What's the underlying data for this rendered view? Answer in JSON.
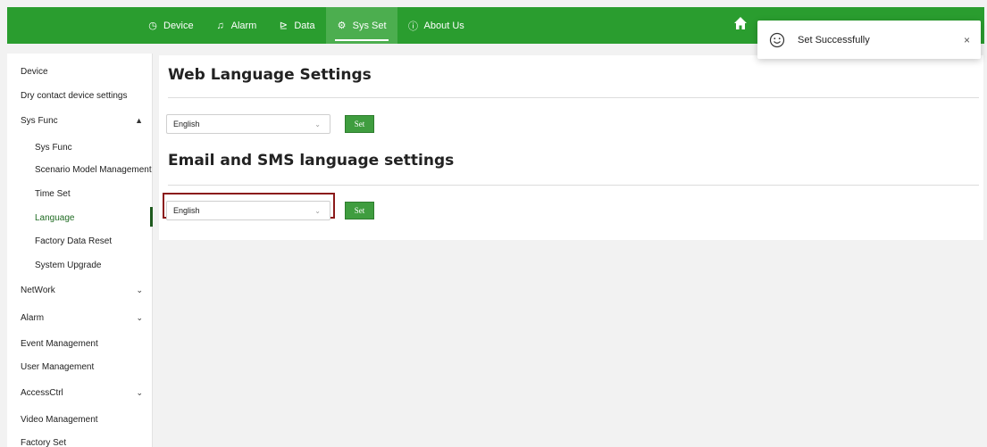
{
  "topnav": {
    "items": [
      {
        "label": "Device",
        "icon": "clock-icon"
      },
      {
        "label": "Alarm",
        "icon": "bell-icon"
      },
      {
        "label": "Data",
        "icon": "chart-icon"
      },
      {
        "label": "Sys Set",
        "icon": "gear-icon"
      },
      {
        "label": "About Us",
        "icon": "info-icon"
      }
    ],
    "active": "Sys Set",
    "brand_color": "#2a9d2f"
  },
  "toast": {
    "message": "Set Successfully",
    "close": "×"
  },
  "sidebar": {
    "items": [
      {
        "label": "Device"
      },
      {
        "label": "Dry contact device settings"
      },
      {
        "label": "Sys Func",
        "chevron": "▲"
      },
      {
        "label": "Sys Func"
      },
      {
        "label": "Scenario Model Management"
      },
      {
        "label": "Time Set"
      },
      {
        "label": "Language"
      },
      {
        "label": "Factory Data Reset"
      },
      {
        "label": "System Upgrade"
      },
      {
        "label": "NetWork",
        "chevron": "⌄"
      },
      {
        "label": "Alarm",
        "chevron": "⌄"
      },
      {
        "label": "Event Management"
      },
      {
        "label": "User Management"
      },
      {
        "label": "AccessCtrl",
        "chevron": "⌄"
      },
      {
        "label": "Video Management"
      },
      {
        "label": "Factory Set"
      }
    ],
    "selected": "Language"
  },
  "web_language": {
    "title": "Web Language Settings",
    "value": "English",
    "set_label": "Set"
  },
  "email_language": {
    "title": "Email and SMS language settings",
    "value": "English",
    "set_label": "Set"
  },
  "colors": {
    "highlight_border": "#8b1a1a",
    "set_button": "#3f9d3f"
  }
}
